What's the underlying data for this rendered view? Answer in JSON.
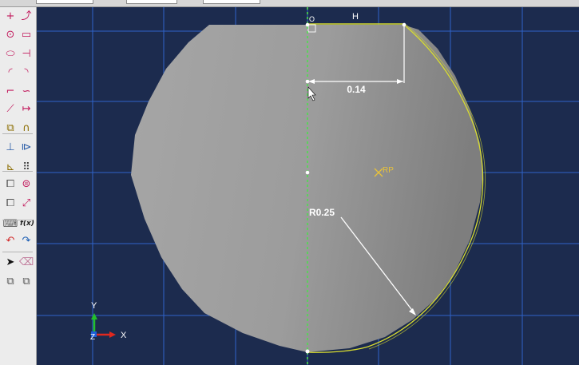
{
  "toolbox": {
    "tools": [
      {
        "name": "add-point-tool",
        "glyph": "+",
        "color": "#c2185b"
      },
      {
        "name": "add-spline-point-tool",
        "glyph": "⤴",
        "color": "#c2185b"
      },
      {
        "name": "circle-tool",
        "glyph": "⊙",
        "color": "#c2185b"
      },
      {
        "name": "rectangle-tool",
        "glyph": "▭",
        "color": "#c2185b"
      },
      {
        "name": "ellipse-tool",
        "glyph": "⬭",
        "color": "#c2185b"
      },
      {
        "name": "construction-line-tool",
        "glyph": "⊣",
        "color": "#c2185b"
      },
      {
        "name": "arc-tool",
        "glyph": "◜",
        "color": "#c2185b"
      },
      {
        "name": "arc-tangent-tool",
        "glyph": "◝",
        "color": "#c2185b"
      },
      {
        "name": "fillet-tool",
        "glyph": "⌐",
        "color": "#c2185b"
      },
      {
        "name": "spline-tool",
        "glyph": "∽",
        "color": "#c2185b"
      },
      {
        "name": "line-tool",
        "glyph": "⟋",
        "color": "#c2185b"
      },
      {
        "name": "dimension-tool",
        "glyph": "↦",
        "color": "#c2185b"
      },
      {
        "name": "offset-tool",
        "glyph": "⧉",
        "color": "#8b6d00"
      },
      {
        "name": "trim-tool",
        "glyph": "∩",
        "color": "#8b6d00"
      },
      {
        "name": "constraint-tool",
        "glyph": "⊥",
        "color": "#2e5fa8"
      },
      {
        "name": "mirror-tool",
        "glyph": "⧐",
        "color": "#2e5fa8"
      },
      {
        "name": "translate-tool",
        "glyph": "⊾",
        "color": "#8b6d00"
      },
      {
        "name": "grid-tool",
        "glyph": "⠿",
        "color": "#333333"
      },
      {
        "name": "copy-tool",
        "glyph": "⧠",
        "color": "#555555"
      },
      {
        "name": "move-tool",
        "glyph": "⊜",
        "color": "#c2185b"
      },
      {
        "name": "rotate-tool",
        "glyph": "⧠",
        "color": "#555555"
      },
      {
        "name": "scale-tool",
        "glyph": "⤢",
        "color": "#c2185b"
      },
      {
        "name": "parameter-tool",
        "glyph": "⌨",
        "color": "#555555"
      },
      {
        "name": "function-tool",
        "glyph": "f(x)",
        "color": "#222222"
      },
      {
        "name": "undo-icon",
        "glyph": "↶",
        "color": "#d32f2f"
      },
      {
        "name": "redo-icon",
        "glyph": "↷",
        "color": "#1e5fb4"
      },
      {
        "name": "select-arrow-icon",
        "glyph": "➤",
        "color": "#111111"
      },
      {
        "name": "eraser-icon",
        "glyph": "⌫",
        "color": "#c07a9a"
      },
      {
        "name": "sketch-options-icon",
        "glyph": "⧉",
        "color": "#555555"
      },
      {
        "name": "save-sketch-icon",
        "glyph": "⧉",
        "color": "#555555"
      },
      {
        "name": "list-icon",
        "glyph": "☰",
        "color": "#555555"
      },
      {
        "name": "grid-view-icon",
        "glyph": "▦",
        "color": "#2e5fa8"
      }
    ]
  },
  "sketch": {
    "dimension_label": "0.14",
    "radius_label": "R0.25",
    "horizontal_constraint_label": "H",
    "origin_marker_label": "O",
    "reference_point_label": "RP"
  },
  "axes": {
    "y_label": "Y",
    "x_label": "X",
    "z_label": "Z"
  },
  "colors": {
    "background": "#1c2b4e",
    "grid": "#2f63c9",
    "region_fill": "#a6a6a6",
    "edge": "#d8dc30",
    "centerline": "#4fdc4f",
    "dimension": "#ffffff",
    "reference_point": "#e8c23a"
  }
}
